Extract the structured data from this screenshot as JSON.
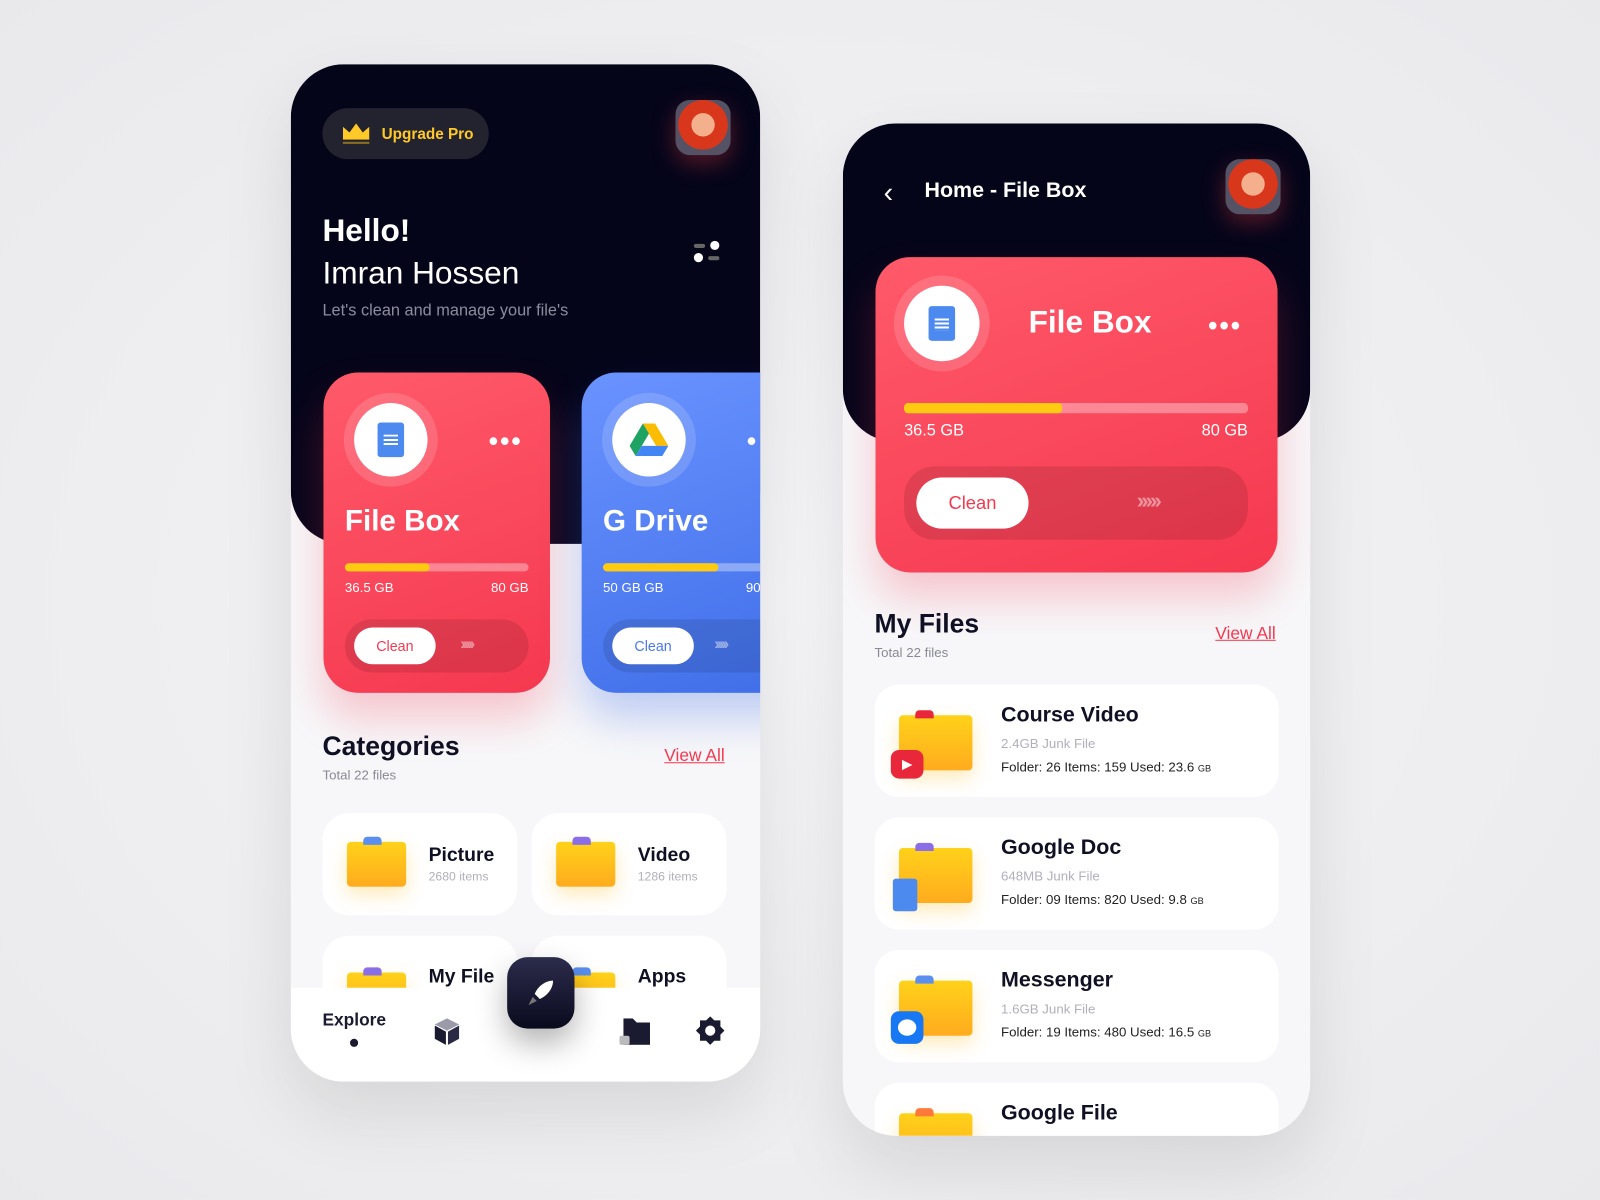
{
  "home": {
    "upgrade_label": "Upgrade Pro",
    "greeting": "Hello!",
    "user_name": "Imran Hossen",
    "tagline": "Let's clean and manage your file's",
    "cards": [
      {
        "title": "File Box",
        "used": "36.5 GB",
        "total": "80 GB",
        "progress": 0.46,
        "clean_label": "Clean",
        "color": "#f5384f",
        "icon": "google-doc-icon"
      },
      {
        "title": "G Drive",
        "used": "50 GB GB",
        "total": "90",
        "progress": 0.55,
        "clean_label": "Clean",
        "color": "#4a78f0",
        "icon": "google-drive-icon"
      }
    ],
    "categories": {
      "title": "Categories",
      "subtitle": "Total 22 files",
      "view_all": "View All",
      "items": [
        {
          "name": "Picture",
          "count": "2680 items"
        },
        {
          "name": "Video",
          "count": "1286 items"
        },
        {
          "name": "My File",
          "count": ""
        },
        {
          "name": "Apps",
          "count": ""
        }
      ]
    },
    "nav": {
      "explore": "Explore",
      "active": "explore"
    }
  },
  "detail": {
    "title": "Home - File Box",
    "card": {
      "title": "File Box",
      "used": "36.5 GB",
      "total": "80 GB",
      "progress": 0.46,
      "clean_label": "Clean"
    },
    "my_files": {
      "title": "My Files",
      "subtitle": "Total 22 files",
      "view_all": "View All",
      "items": [
        {
          "name": "Course Video",
          "junk": "2.4GB Junk File",
          "meta": "Folder: 26 Items: 159 Used: 23.6",
          "unit": "GB",
          "badge": "youtube-icon"
        },
        {
          "name": "Google Doc",
          "junk": "648MB Junk File",
          "meta": "Folder: 09  Items: 820  Used: 9.8",
          "unit": "GB",
          "badge": "google-doc-icon"
        },
        {
          "name": "Messenger",
          "junk": "1.6GB Junk File",
          "meta": "Folder: 19  Items: 480  Used: 16.5",
          "unit": "GB",
          "badge": "messenger-icon"
        },
        {
          "name": "Google File",
          "junk": "",
          "meta": "",
          "unit": "",
          "badge": ""
        }
      ]
    }
  },
  "colors": {
    "dark": "#05051a",
    "accent_red": "#f5384f",
    "accent_blue": "#4a78f0",
    "progress": "#ffcb11",
    "upgrade": "#ffc928"
  }
}
